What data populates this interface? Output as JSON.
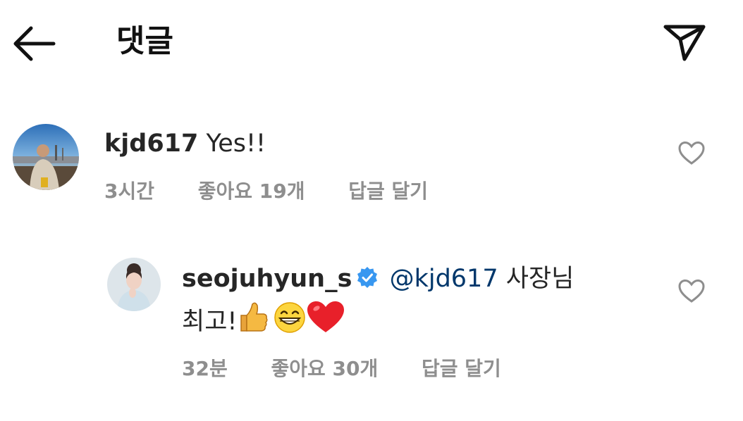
{
  "header": {
    "title": "댓글",
    "back_icon": "arrow-left-icon",
    "share_icon": "paper-plane-icon"
  },
  "comments": [
    {
      "username": "kjd617",
      "text": "Yes!!",
      "time": "3시간",
      "likes": "좋아요 19개",
      "reply": "답글 달기",
      "avatar_icon": "profile-photo"
    }
  ],
  "replies": [
    {
      "username": "seojuhyun_s",
      "verified": true,
      "mention": "@kjd617",
      "text_line1": "사장님",
      "text_line2": "최고!",
      "emojis": [
        "thumbs-up-icon",
        "grinning-face-icon",
        "red-heart-icon"
      ],
      "time": "32분",
      "likes": "좋아요 30개",
      "reply": "답글 달기",
      "avatar_icon": "profile-photo"
    }
  ],
  "colors": {
    "text": "#262626",
    "muted": "#8e8e8e",
    "mention": "#00376b",
    "verified": "#3897f0"
  }
}
